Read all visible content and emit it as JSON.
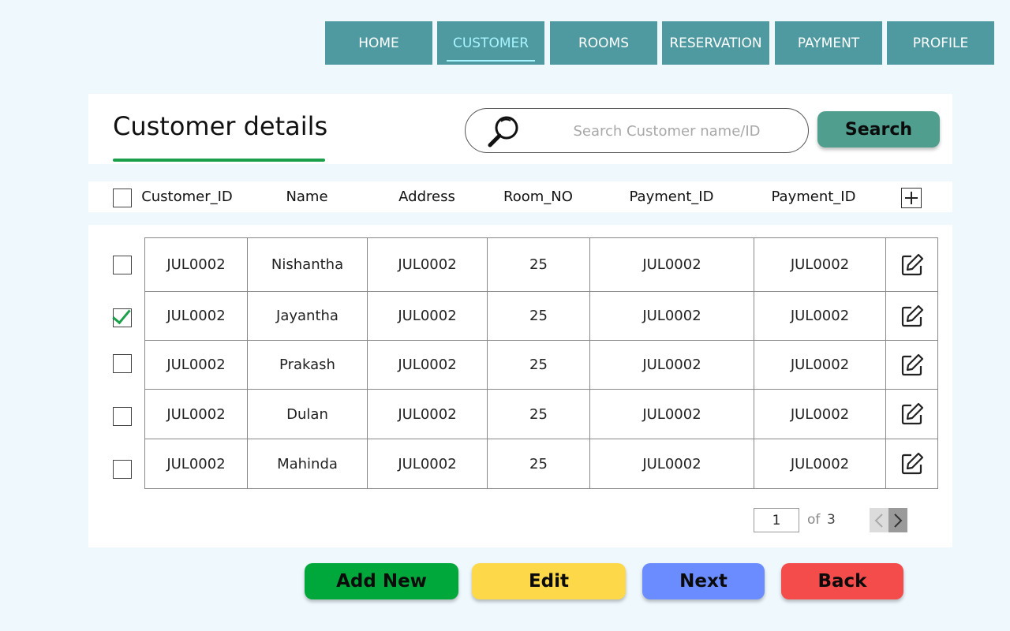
{
  "nav": {
    "tabs": [
      {
        "label": "HOME"
      },
      {
        "label": "CUSTOMER"
      },
      {
        "label": "ROOMS"
      },
      {
        "label": "RESERVATION"
      },
      {
        "label": "PAYMENT"
      },
      {
        "label": "PROFILE"
      }
    ],
    "active": "CUSTOMER"
  },
  "header": {
    "title": "Customer details",
    "search_placeholder": "Search Customer name/ID",
    "search_button": "Search"
  },
  "table": {
    "columns": [
      "Customer_ID",
      "Name",
      "Address",
      "Room_NO",
      "Payment_ID",
      "Payment_ID"
    ],
    "rows": [
      {
        "checked": false,
        "cells": [
          "JUL0002",
          "Nishantha",
          "JUL0002",
          "25",
          "JUL0002",
          "JUL0002"
        ]
      },
      {
        "checked": true,
        "cells": [
          "JUL0002",
          "Jayantha",
          "JUL0002",
          "25",
          "JUL0002",
          "JUL0002"
        ]
      },
      {
        "checked": false,
        "cells": [
          "JUL0002",
          "Prakash",
          "JUL0002",
          "25",
          "JUL0002",
          "JUL0002"
        ]
      },
      {
        "checked": false,
        "cells": [
          "JUL0002",
          "Dulan",
          "JUL0002",
          "25",
          "JUL0002",
          "JUL0002"
        ]
      },
      {
        "checked": false,
        "cells": [
          "JUL0002",
          "Mahinda",
          "JUL0002",
          "25",
          "JUL0002",
          "JUL0002"
        ]
      }
    ]
  },
  "pagination": {
    "current_page": "1",
    "of_label": "of",
    "total_pages": "3"
  },
  "actions": {
    "add_new": "Add New",
    "edit": "Edit",
    "next": "Next",
    "back": "Back"
  },
  "colors": {
    "nav_bg": "#4f9aa0",
    "active_tab_text": "#a8f4ff",
    "title_underline": "#1aa04a",
    "search_button": "#4f9e8e",
    "add_new": "#00a83c",
    "edit": "#fdd94a",
    "next": "#6b8cff",
    "back": "#f44b4b",
    "checkmark": "#1aa04a"
  },
  "icons": {
    "search": "magnifier-icon",
    "row_action": "edit-icon",
    "add_column": "plus-box-icon",
    "prev": "chevron-left-icon",
    "next": "chevron-right-icon"
  }
}
